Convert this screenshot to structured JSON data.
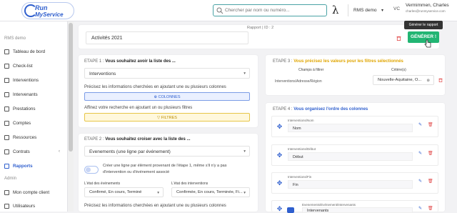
{
  "header": {
    "logo_line1": "Run",
    "logo_line2": "MyService",
    "search_placeholder": "Chercher par nom ou numéro...",
    "lambda": "λ",
    "environment": "RMS demo",
    "user_initials": "VC",
    "user_name": "Vermimmen, Charles",
    "user_email": "charles@runmyservice.com",
    "tooltip": "Générer le rapport"
  },
  "sidebar": {
    "section1": "RMS demo",
    "items": [
      {
        "label": "Tableau de bord"
      },
      {
        "label": "Check-list"
      },
      {
        "label": "Interventions"
      },
      {
        "label": "Intervenants"
      },
      {
        "label": "Prestations"
      },
      {
        "label": "Comptes"
      },
      {
        "label": "Ressources"
      },
      {
        "label": "Contrats"
      },
      {
        "label": "Rapports"
      }
    ],
    "section2": "Admin",
    "admin_items": [
      {
        "label": "Mon compte client"
      },
      {
        "label": "Utilisateurs"
      }
    ]
  },
  "report": {
    "title": "Activités 2021",
    "id_label": "Rapport | ID : 2",
    "generate_label": "GÉNÉRER !"
  },
  "step1": {
    "prefix": "ETAPE 1 :",
    "title": "Vous souhaitez avoir la liste des ...",
    "select": "Interventions",
    "hint1": "Précisez les informations cherchées en ajoutant une ou plusieurs colonnes",
    "columns_btn": "COLONNES",
    "hint2": "Affinez votre recherche en ajoutant un ou plusieurs filtres",
    "filters_btn": "FILTRES"
  },
  "step2": {
    "prefix": "ETAPE 2 :",
    "title": "Vous souhaitez croiser avec la liste des ...",
    "select": "Evenements (une ligne par événement)",
    "toggle_text1": "Créer une ligne par élément provenant de l'étape 1, même s'il n'y a pas",
    "toggle_text2": "d'intervention ou d'événement associé",
    "event_state_label": "L'état des événements",
    "event_state_value": "Confirmé, En cours, Terminé",
    "intervention_state_label": "L'état des interventions",
    "intervention_state_value": "Confirmée, En cours, Terminée, Fi...",
    "hint": "Précisez les informations cherchées en ajoutant une ou plusieurs colonnes"
  },
  "step3": {
    "prefix": "ETAPE 3 :",
    "title": "Vous précisez les valeurs pour les filtres sélectionnés",
    "col_field": "Champs à filtrer",
    "col_criteria": "Critère(s)",
    "field": "Interventions/Adresse/Région",
    "criteria": "Nouvelle-Aquitaine, O..."
  },
  "step4": {
    "prefix": "ETAPE 4 :",
    "title": "Vous organisez l'ordre des colonnes",
    "columns": [
      {
        "caption": "Interventions/Nom",
        "value": "Nom"
      },
      {
        "caption": "Interventions/Début",
        "value": "Début"
      },
      {
        "caption": "Interventions/Fin",
        "value": "Fin"
      },
      {
        "caption": "Evenements/Evénement/Intervenants",
        "value": "Intervenants"
      }
    ]
  }
}
